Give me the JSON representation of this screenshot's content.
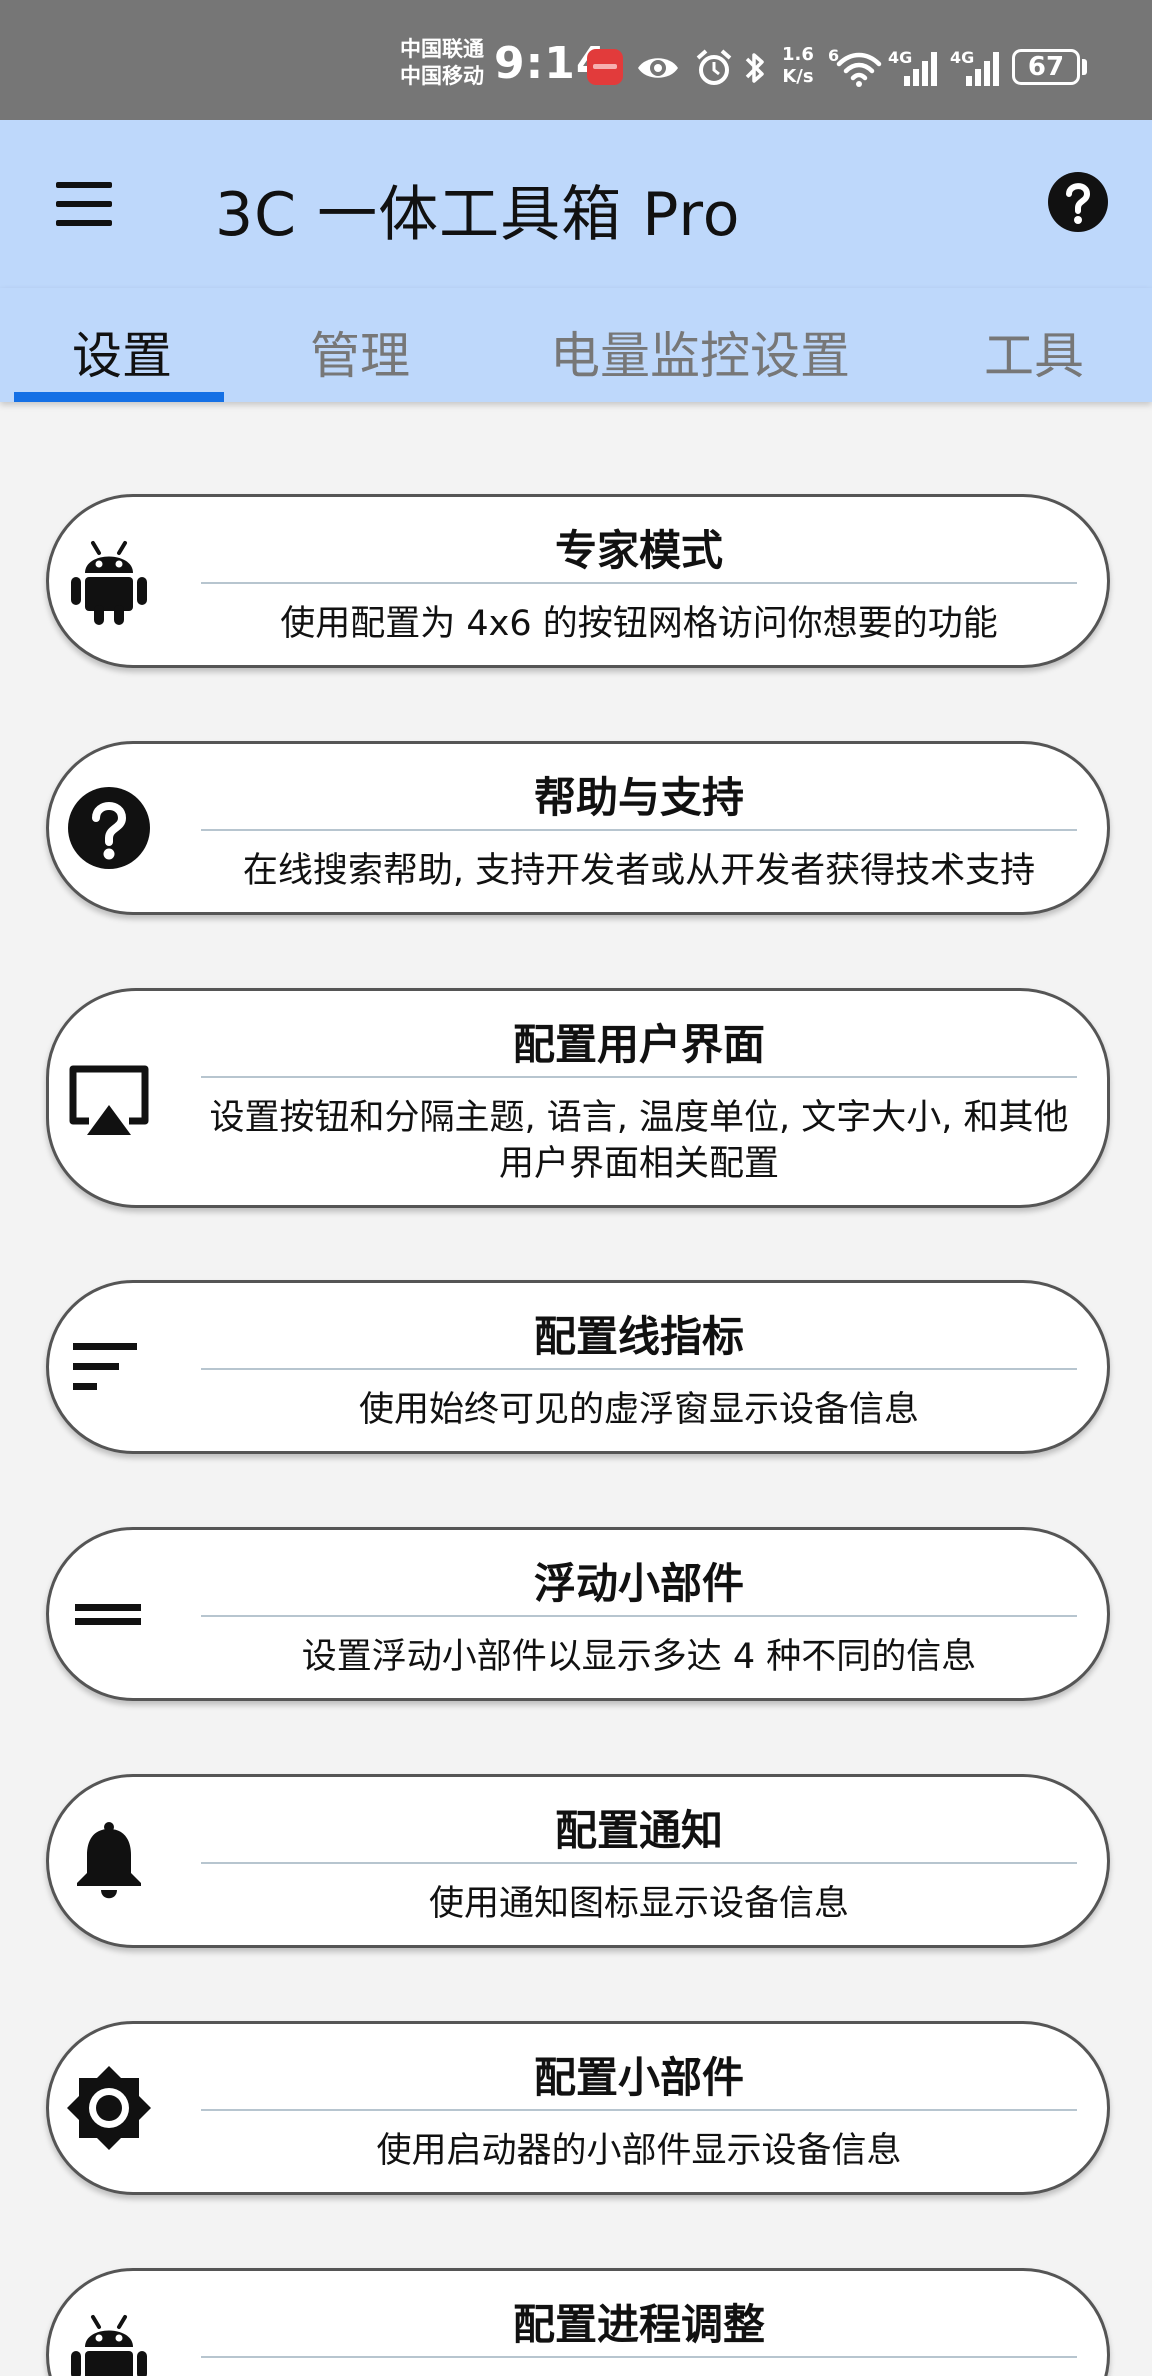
{
  "status_bar": {
    "carrier_1": "中国联通",
    "carrier_2": "中国移动",
    "time": "9:14",
    "speed_value": "1.6",
    "speed_unit": "K/s",
    "wifi_label": "6",
    "net_label_1": "4G",
    "net_label_2": "4G",
    "battery": "67"
  },
  "app_bar": {
    "title": "3C 一体工具箱 Pro"
  },
  "tabs": [
    {
      "label": "设置",
      "active": true
    },
    {
      "label": "管理",
      "active": false
    },
    {
      "label": "电量监控设置",
      "active": false
    },
    {
      "label": "工具",
      "active": false
    }
  ],
  "colors": {
    "app_bar": "#bed8fb",
    "tab_indicator": "#1570e5",
    "status_bar": "#767676"
  },
  "cards": [
    {
      "icon": "android-icon",
      "title": "专家模式",
      "description": "使用配置为 4x6 的按钮网格访问你想要的功能"
    },
    {
      "icon": "help-circle-icon",
      "title": "帮助与支持",
      "description": "在线搜索帮助, 支持开发者或从开发者获得技术支持"
    },
    {
      "icon": "cast-screen-icon",
      "title": "配置用户界面",
      "description": "设置按钮和分隔主题, 语言, 温度单位, 文字大小, 和其他用户界面相关配置"
    },
    {
      "icon": "sort-lines-icon",
      "title": "配置线指标",
      "description": "使用始终可见的虚浮窗显示设备信息"
    },
    {
      "icon": "equal-lines-icon",
      "title": "浮动小部件",
      "description": "设置浮动小部件以显示多达 4 种不同的信息"
    },
    {
      "icon": "bell-icon",
      "title": "配置通知",
      "description": "使用通知图标显示设备信息"
    },
    {
      "icon": "brightness-icon",
      "title": "配置小部件",
      "description": "使用启动器的小部件显示设备信息"
    },
    {
      "icon": "android-icon",
      "title": "配置进程调整",
      "description": ""
    }
  ]
}
